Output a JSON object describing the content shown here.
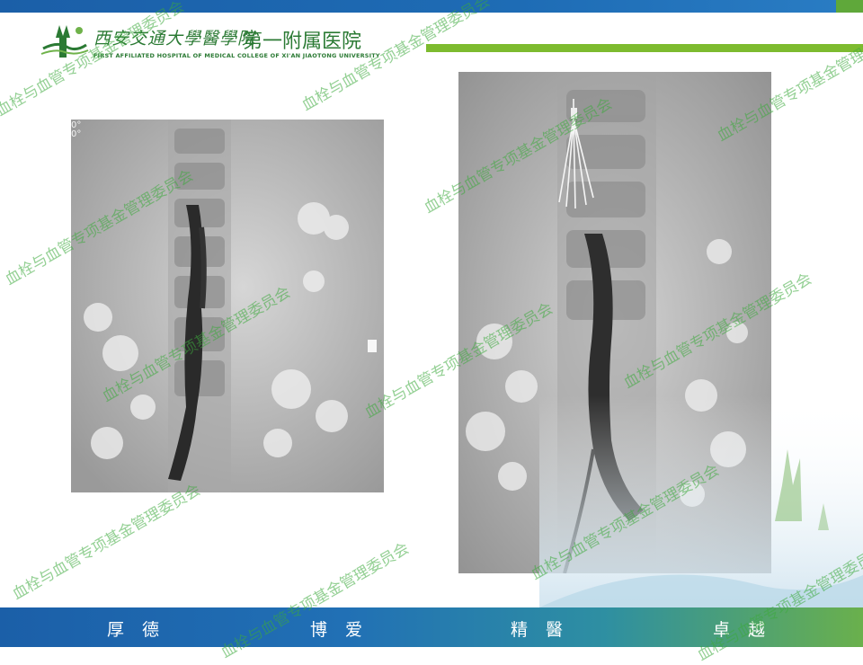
{
  "header": {
    "logo_cn_name": "西安交通大學醫學院",
    "logo_cn_dept": "第一附属医院",
    "logo_en": "FIRST AFFILIATED HOSPITAL OF MEDICAL COLLEGE OF XI'AN JIAOTONG UNIVERSITY"
  },
  "images": {
    "left_corner_line1": "0°",
    "left_corner_line2": "0°"
  },
  "footer": {
    "motto": [
      "厚德",
      "博爱",
      "精醫",
      "卓越"
    ]
  },
  "watermark": {
    "text": "血栓与血管专项基金管理委员会"
  },
  "colors": {
    "brand_blue": "#1b5fa8",
    "brand_green": "#7dbb2f",
    "watermark_green": "#3caa3c"
  }
}
